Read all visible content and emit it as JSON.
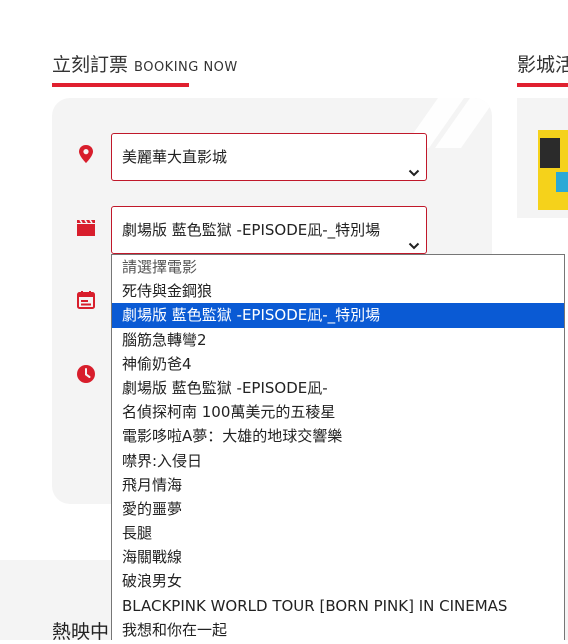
{
  "headings": {
    "booking_zh": "立刻訂票",
    "booking_en": "BOOKING NOW",
    "cinema_activities": "影城活",
    "now_showing": "熱映中"
  },
  "booking": {
    "cinema_select": {
      "value": "美麗華大直影城"
    },
    "movie_select": {
      "value": "劇場版 藍色監獄 -EPISODE凪-_特別場"
    }
  },
  "movie_options": [
    "請選擇電影",
    "死侍與金鋼狼",
    "劇場版 藍色監獄 -EPISODE凪-_特別場",
    "腦筋急轉彎2",
    "神偷奶爸4",
    "劇場版 藍色監獄 -EPISODE凪-",
    "名偵探柯南 100萬美元的五稜星",
    "電影哆啦A夢：大雄的地球交響樂",
    "噤界:入侵日",
    "飛月情海",
    "愛的噩夢",
    "長腿",
    "海關戰線",
    "破浪男女",
    "BLACKPINK WORLD TOUR [BORN PINK] IN CINEMAS",
    "我想和你在一起"
  ],
  "selected_option_index": 2,
  "icons": [
    "location-pin-icon",
    "clapperboard-icon",
    "calendar-icon",
    "clock-icon",
    "chevron-down-icon"
  ],
  "colors": {
    "accent": "#e0202f",
    "select_border": "#c0182a",
    "highlight": "#0a5ad4",
    "panel": "#f4f4f4"
  }
}
